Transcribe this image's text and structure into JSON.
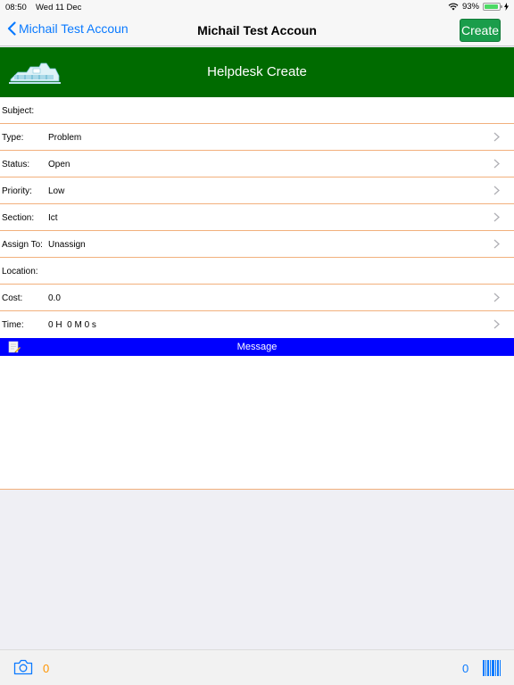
{
  "statusbar": {
    "time": "08:50",
    "date": "Wed 11 Dec",
    "battery": "93%",
    "battery_level": 0.93
  },
  "navbar": {
    "back_label": "Michail Test Accoun",
    "title": "Michail Test Accoun",
    "create_label": "Create"
  },
  "banner": {
    "title": "Helpdesk Create"
  },
  "form": {
    "subject": {
      "label": "Subject:",
      "value": ""
    },
    "type": {
      "label": "Type:",
      "value": "Problem"
    },
    "status": {
      "label": "Status:",
      "value": "Open"
    },
    "priority": {
      "label": "Priority:",
      "value": "Low"
    },
    "section": {
      "label": "Section:",
      "value": "Ict"
    },
    "assign_to": {
      "label": "Assign To:",
      "value": "Unassign"
    },
    "location": {
      "label": "Location:",
      "value": ""
    },
    "cost": {
      "label": "Cost:",
      "value": "0.0"
    },
    "time": {
      "label": "Time:",
      "value": "0 H  0 M 0 s"
    }
  },
  "message": {
    "label": "Message",
    "value": ""
  },
  "bottombar": {
    "photo_count": "0",
    "barcode_count": "0"
  },
  "colors": {
    "accent": "#0a7aff",
    "banner": "#006b00",
    "create_button": "#1a9d4b",
    "message_bar": "#0000ff",
    "row_divider": "#f2b07c",
    "photo_count": "#ff9500"
  },
  "icons": {
    "back": "chevron-left-icon",
    "row": "chevron-right-icon",
    "logo": "building-logo-icon",
    "message": "note-pencil-icon",
    "camera": "camera-icon",
    "barcode": "barcode-icon",
    "wifi": "wifi-icon",
    "battery": "battery-icon",
    "charging": "charging-bolt-icon"
  }
}
